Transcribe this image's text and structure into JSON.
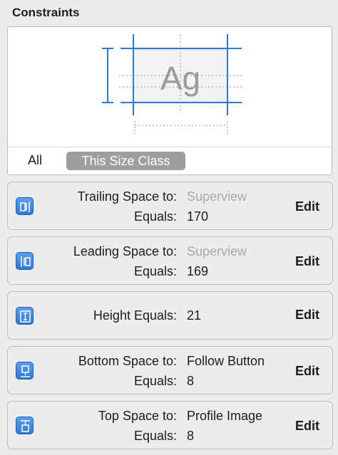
{
  "panel": {
    "title": "Constraints"
  },
  "preview": {
    "sample_text": "Ag"
  },
  "tabs": {
    "all": "All",
    "this_size_class": "This Size Class"
  },
  "colors": {
    "accent": "#2a7bd6",
    "tab_selected": "#9e9e9e",
    "placeholder": "#a9a9a9"
  },
  "constraints": [
    {
      "icon": "trailing-space-icon",
      "label1": "Trailing Space to:",
      "value1": "Superview",
      "label2": "Equals:",
      "value2": "170",
      "edit": "Edit"
    },
    {
      "icon": "leading-space-icon",
      "label1": "Leading Space to:",
      "value1": "Superview",
      "label2": "Equals:",
      "value2": "169",
      "edit": "Edit"
    },
    {
      "icon": "height-icon",
      "label1": "Height Equals:",
      "value1": "21",
      "edit": "Edit"
    },
    {
      "icon": "bottom-space-icon",
      "label1": "Bottom Space to:",
      "value1": "Follow Button",
      "label2": "Equals:",
      "value2": "8",
      "edit": "Edit"
    },
    {
      "icon": "top-space-icon",
      "label1": "Top Space to:",
      "value1": "Profile Image",
      "label2": "Equals:",
      "value2": "8",
      "edit": "Edit"
    }
  ]
}
